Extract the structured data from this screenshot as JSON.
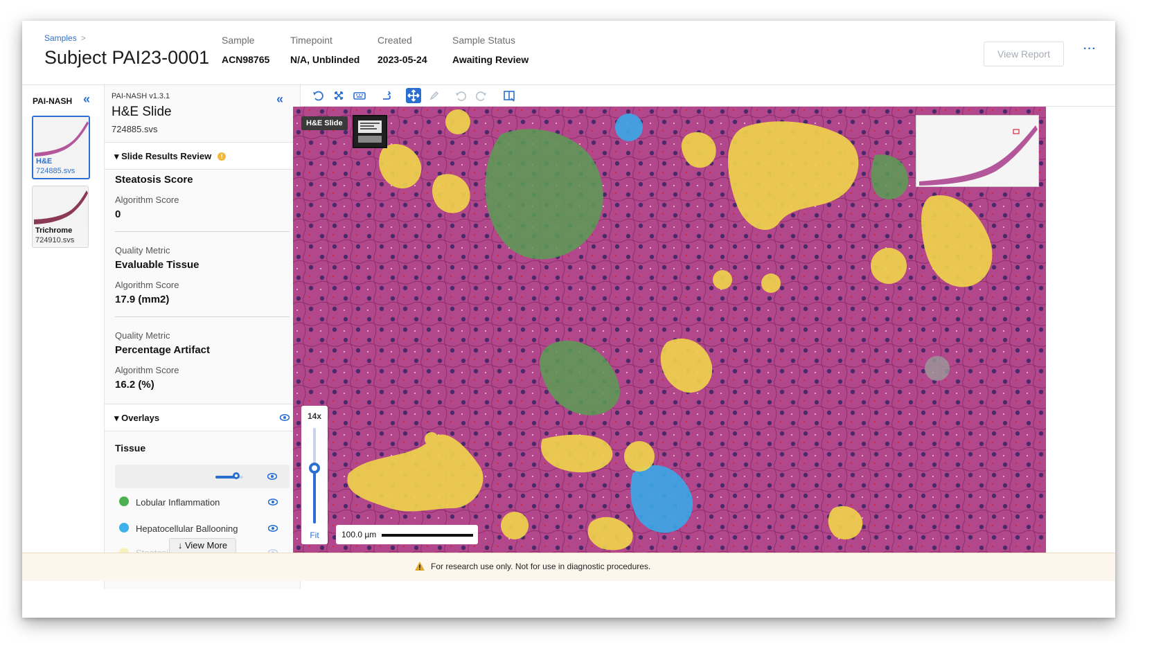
{
  "header": {
    "breadcrumb": "Samples",
    "breadcrumb_sep": ">",
    "subject": "Subject PAI23-0001",
    "sample_label": "Sample",
    "sample_value": "ACN98765",
    "timepoint_label": "Timepoint",
    "timepoint_value": "N/A, Unblinded",
    "created_label": "Created",
    "created_value": "2023-05-24",
    "status_label": "Sample Status",
    "status_value": "Awaiting Review",
    "view_report": "View Report",
    "more": "···"
  },
  "rail": {
    "title": "PAI-NASH",
    "collapse": "«",
    "slides": [
      {
        "stain": "H&E",
        "file": "724885.svs",
        "active": true
      },
      {
        "stain": "Trichrome",
        "file": "724910.svs",
        "active": false
      }
    ]
  },
  "panel": {
    "algorithm": "PAI-NASH v1.3.1",
    "slide_name": "H&E Slide",
    "file": "724885.svs",
    "collapse": "«",
    "results_title": "Slide Results Review",
    "results_badge": "!",
    "metrics": [
      {
        "metric_label": "",
        "metric_name": "Steatosis Score",
        "score_label": "Algorithm Score",
        "score": "0"
      },
      {
        "metric_label": "Quality Metric",
        "metric_name": "Evaluable Tissue",
        "score_label": "Algorithm Score",
        "score": "17.9 (mm2)"
      },
      {
        "metric_label": "Quality Metric",
        "metric_name": "Percentage Artifact",
        "score_label": "Algorithm Score",
        "score": "16.2 (%)"
      }
    ],
    "overlays_title": "Overlays",
    "tissue_label": "Tissue",
    "tissue_opacity": 0.75,
    "legend": [
      {
        "name": "Lobular Inflammation",
        "color": "#4caf50"
      },
      {
        "name": "Hepatocellular Ballooning",
        "color": "#3db2ea"
      },
      {
        "name": "Steatosis",
        "color": "#f2e34a"
      }
    ],
    "view_more": "↓ View More"
  },
  "toolbar": {
    "icons": [
      "rotate-icon",
      "fullscreen-icon",
      "keyboard-icon",
      "measure-icon",
      "pan-icon",
      "annotate-icon",
      "undo-icon",
      "redo-icon",
      "split-view-icon"
    ]
  },
  "viewer": {
    "slide_tag": "H&E Slide",
    "zoom": "14x",
    "fit": "Fit",
    "scale": "100.0 µm",
    "zoom_level": 0.58
  },
  "footer": {
    "notice": "For research use only. Not for use in diagnostic procedures."
  },
  "colors": {
    "accent": "#2b6fd1",
    "tissue": "#b3478b",
    "inflammation": "#4caf50",
    "ballooning": "#3db2ea",
    "steatosis": "#f2d24a"
  }
}
